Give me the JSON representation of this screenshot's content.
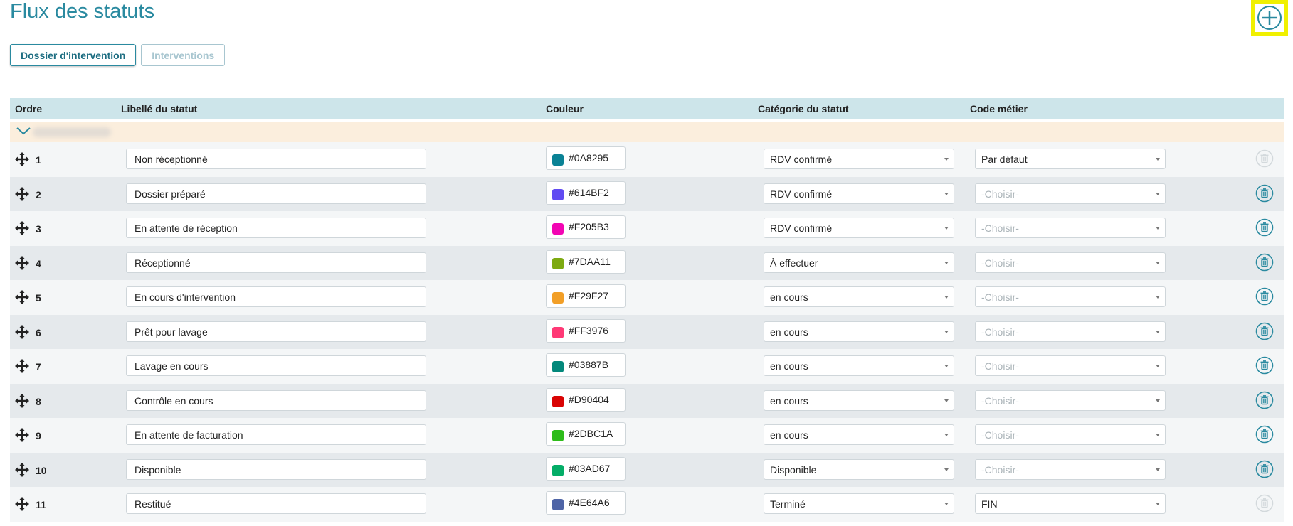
{
  "page": {
    "title": "Flux des statuts"
  },
  "tabs": [
    {
      "label": "Dossier d'intervention",
      "active": true
    },
    {
      "label": "Interventions",
      "active": false
    }
  ],
  "table": {
    "headers": {
      "order": "Ordre",
      "label": "Libellé du statut",
      "color": "Couleur",
      "category": "Catégorie du statut",
      "code": "Code métier"
    },
    "rows": [
      {
        "order": "1",
        "label": "Non réceptionné",
        "color": "#0A8295",
        "category": "RDV confirmé",
        "code": "Par défaut",
        "code_placeholder": false,
        "deletable": false
      },
      {
        "order": "2",
        "label": "Dossier préparé",
        "color": "#614BF2",
        "category": "RDV confirmé",
        "code": "-Choisir-",
        "code_placeholder": true,
        "deletable": true
      },
      {
        "order": "3",
        "label": "En attente de réception",
        "color": "#F205B3",
        "category": "RDV confirmé",
        "code": "-Choisir-",
        "code_placeholder": true,
        "deletable": true
      },
      {
        "order": "4",
        "label": "Réceptionné",
        "color": "#7DAA11",
        "category": "À effectuer",
        "code": "-Choisir-",
        "code_placeholder": true,
        "deletable": true
      },
      {
        "order": "5",
        "label": "En cours d'intervention",
        "color": "#F29F27",
        "category": "en cours",
        "code": "-Choisir-",
        "code_placeholder": true,
        "deletable": true
      },
      {
        "order": "6",
        "label": "Prêt pour lavage",
        "color": "#FF3976",
        "category": "en cours",
        "code": "-Choisir-",
        "code_placeholder": true,
        "deletable": true
      },
      {
        "order": "7",
        "label": "Lavage en cours",
        "color": "#03887B",
        "category": "en cours",
        "code": "-Choisir-",
        "code_placeholder": true,
        "deletable": true
      },
      {
        "order": "8",
        "label": "Contrôle en cours",
        "color": "#D90404",
        "category": "en cours",
        "code": "-Choisir-",
        "code_placeholder": true,
        "deletable": true
      },
      {
        "order": "9",
        "label": "En attente de facturation",
        "color": "#2DBC1A",
        "category": "en cours",
        "code": "-Choisir-",
        "code_placeholder": true,
        "deletable": true
      },
      {
        "order": "10",
        "label": "Disponible",
        "color": "#03AD67",
        "category": "Disponible",
        "code": "-Choisir-",
        "code_placeholder": true,
        "deletable": true
      },
      {
        "order": "11",
        "label": "Restitué",
        "color": "#4E64A6",
        "category": "Terminé",
        "code": "FIN",
        "code_placeholder": false,
        "deletable": false
      }
    ]
  },
  "icons": {
    "add": "plus-circle-icon",
    "chevron": "chevron-down-icon",
    "drag": "move-arrows-icon",
    "delete": "trash-icon"
  },
  "colors": {
    "accent": "#2a8aa0",
    "header_bg": "#cde5ea",
    "group_bg": "#fbeedd",
    "highlight": "#f0f000",
    "trash_active": "#2a8aa0",
    "trash_disabled": "#d3d9dc"
  }
}
